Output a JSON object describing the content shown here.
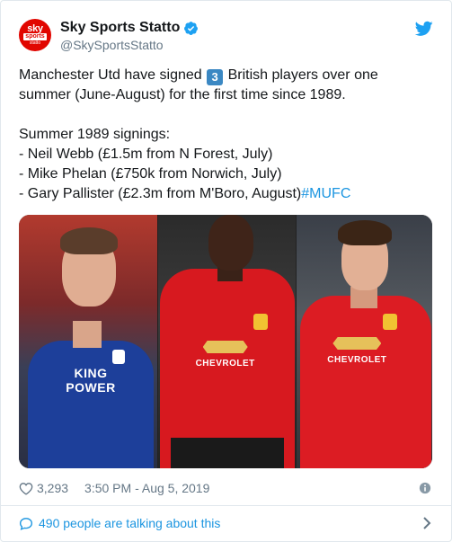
{
  "author": {
    "display_name": "Sky Sports Statto",
    "handle": "@SkySportsStatto",
    "avatar_top": "sky",
    "avatar_mid": "sports",
    "avatar_bot": "statto",
    "verified": true
  },
  "tweet": {
    "line1_before": "Manchester Utd have signed ",
    "line1_emoji": "3",
    "line1_after": " British players over one",
    "line2": "summer (June-August) for the first time since 1989.",
    "line3": "Summer 1989 signings:",
    "line4": "- Neil Webb (£1.5m from N Forest, July)",
    "line5": "- Mike Phelan (£750k from Norwich, July)",
    "line6": "- Gary Pallister (£2.3m from M'Boro, August)",
    "hashtag": "#MUFC"
  },
  "media": {
    "panel1_sponsor_top": "KING",
    "panel1_sponsor_bottom": "POWER",
    "panel2_sponsor": "CHEVROLET",
    "panel3_sponsor": "CHEVROLET"
  },
  "footer": {
    "likes": "3,293",
    "timestamp": "3:50 PM - Aug 5, 2019",
    "talking": "490 people are talking about this"
  },
  "colors": {
    "link": "#1b95e0",
    "muted": "#657786",
    "brand_red": "#e10600",
    "emoji_blue": "#3b88c3"
  },
  "icons": [
    "verified-icon",
    "twitter-bird-icon",
    "heart-icon",
    "info-icon",
    "chat-bubble-icon",
    "chevron-right-icon"
  ]
}
